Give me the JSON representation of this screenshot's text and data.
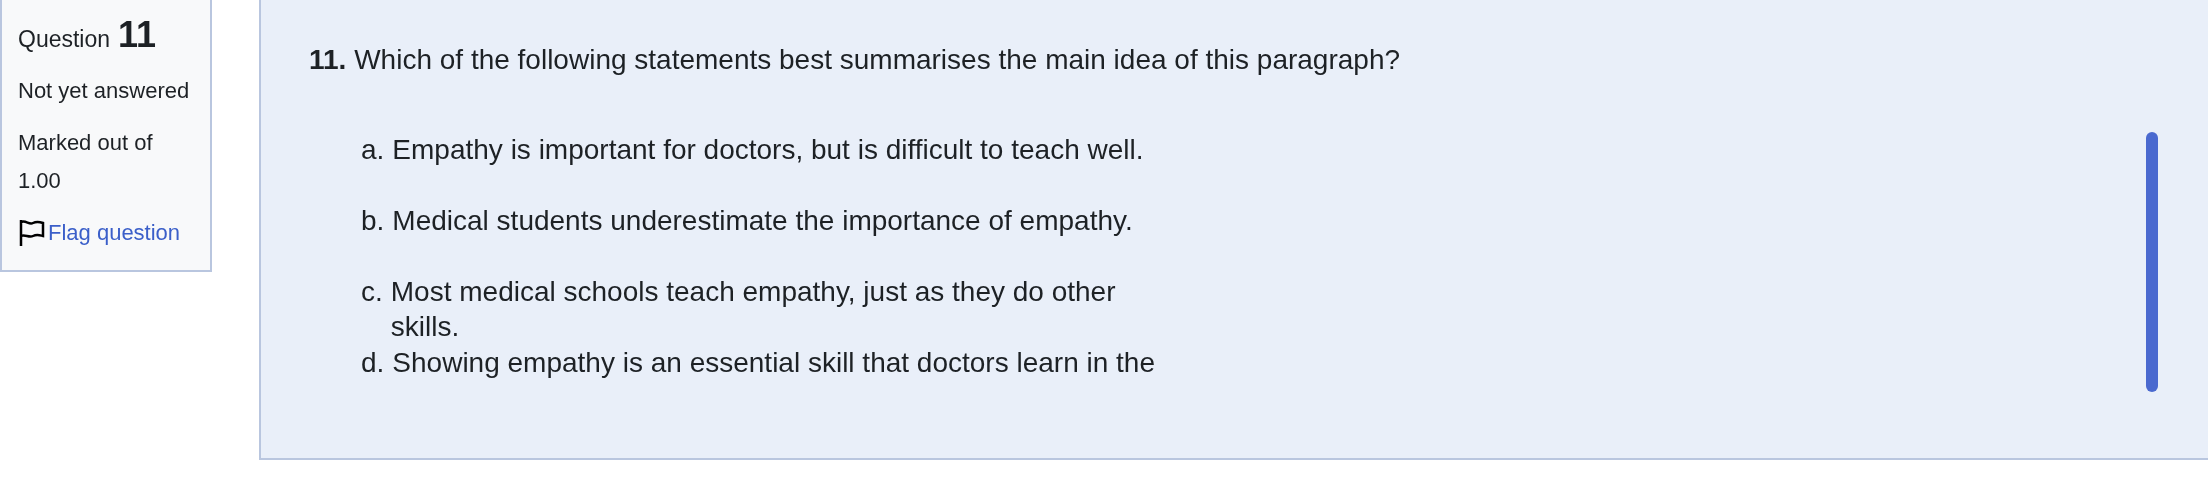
{
  "info": {
    "label": "Question",
    "number": "11",
    "state": "Not yet answered",
    "marks": "Marked out of 1.00",
    "flag": "Flag question"
  },
  "question": {
    "number": "11.",
    "text": "Which of the following statements best summarises the main idea of this paragraph?",
    "options": [
      {
        "letter": "a.",
        "text": "Empathy is important for doctors, but is difficult to teach well."
      },
      {
        "letter": "b.",
        "text": "Medical students underestimate the importance of empathy."
      },
      {
        "letter": "c.",
        "text": "Most medical schools teach empathy, just as they do other skills."
      },
      {
        "letter": "d.",
        "text": "Showing empathy is an essential skill that doctors learn in the"
      }
    ]
  }
}
